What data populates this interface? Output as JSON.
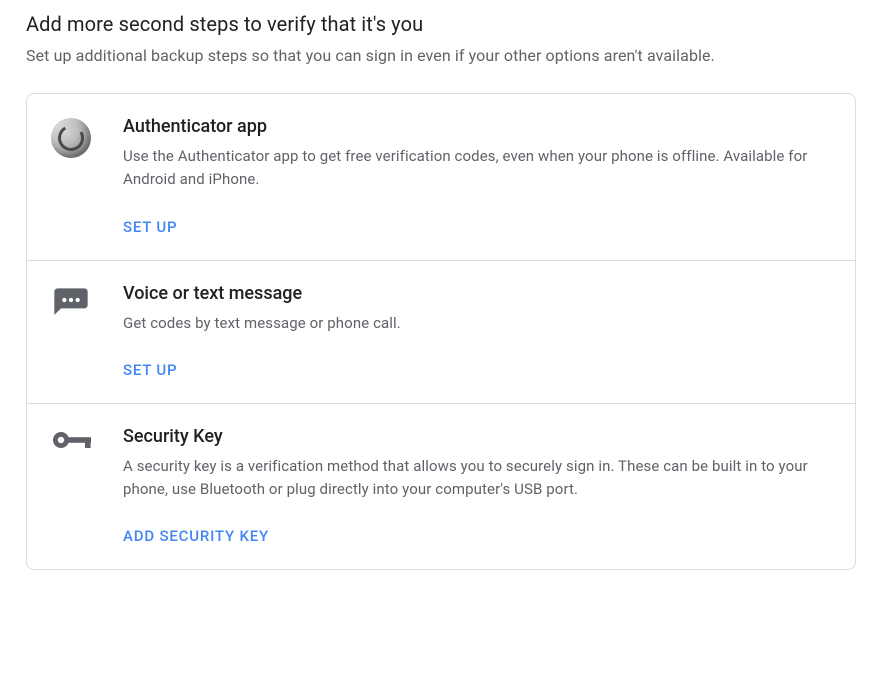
{
  "section": {
    "title": "Add more second steps to verify that it's you",
    "subtitle": "Set up additional backup steps so that you can sign in even if your other options aren't available."
  },
  "steps": [
    {
      "icon": "authenticator-icon",
      "title": "Authenticator app",
      "description": "Use the Authenticator app to get free verification codes, even when your phone is offline. Available for Android and iPhone.",
      "action_label": "Set up"
    },
    {
      "icon": "sms-icon",
      "title": "Voice or text message",
      "description": "Get codes by text message or phone call.",
      "action_label": "Set up"
    },
    {
      "icon": "key-icon",
      "title": "Security Key",
      "description": "A security key is a verification method that allows you to securely sign in. These can be built in to your phone, use Bluetooth or plug directly into your computer's USB port.",
      "action_label": "Add Security Key"
    }
  ]
}
